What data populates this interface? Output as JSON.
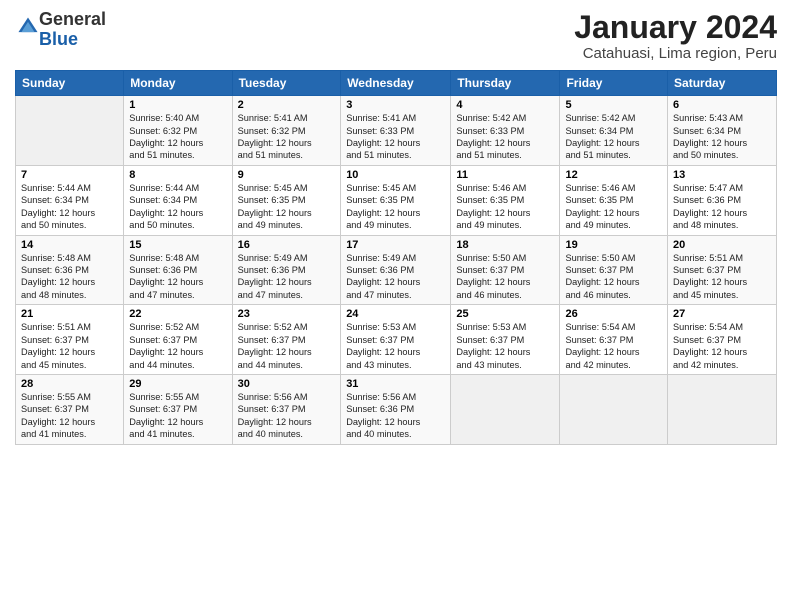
{
  "logo": {
    "general": "General",
    "blue": "Blue"
  },
  "header": {
    "title": "January 2024",
    "subtitle": "Catahuasi, Lima region, Peru"
  },
  "columns": [
    "Sunday",
    "Monday",
    "Tuesday",
    "Wednesday",
    "Thursday",
    "Friday",
    "Saturday"
  ],
  "weeks": [
    [
      {
        "day": "",
        "info": ""
      },
      {
        "day": "1",
        "info": "Sunrise: 5:40 AM\nSunset: 6:32 PM\nDaylight: 12 hours\nand 51 minutes."
      },
      {
        "day": "2",
        "info": "Sunrise: 5:41 AM\nSunset: 6:32 PM\nDaylight: 12 hours\nand 51 minutes."
      },
      {
        "day": "3",
        "info": "Sunrise: 5:41 AM\nSunset: 6:33 PM\nDaylight: 12 hours\nand 51 minutes."
      },
      {
        "day": "4",
        "info": "Sunrise: 5:42 AM\nSunset: 6:33 PM\nDaylight: 12 hours\nand 51 minutes."
      },
      {
        "day": "5",
        "info": "Sunrise: 5:42 AM\nSunset: 6:34 PM\nDaylight: 12 hours\nand 51 minutes."
      },
      {
        "day": "6",
        "info": "Sunrise: 5:43 AM\nSunset: 6:34 PM\nDaylight: 12 hours\nand 50 minutes."
      }
    ],
    [
      {
        "day": "7",
        "info": "Sunrise: 5:44 AM\nSunset: 6:34 PM\nDaylight: 12 hours\nand 50 minutes."
      },
      {
        "day": "8",
        "info": "Sunrise: 5:44 AM\nSunset: 6:34 PM\nDaylight: 12 hours\nand 50 minutes."
      },
      {
        "day": "9",
        "info": "Sunrise: 5:45 AM\nSunset: 6:35 PM\nDaylight: 12 hours\nand 49 minutes."
      },
      {
        "day": "10",
        "info": "Sunrise: 5:45 AM\nSunset: 6:35 PM\nDaylight: 12 hours\nand 49 minutes."
      },
      {
        "day": "11",
        "info": "Sunrise: 5:46 AM\nSunset: 6:35 PM\nDaylight: 12 hours\nand 49 minutes."
      },
      {
        "day": "12",
        "info": "Sunrise: 5:46 AM\nSunset: 6:35 PM\nDaylight: 12 hours\nand 49 minutes."
      },
      {
        "day": "13",
        "info": "Sunrise: 5:47 AM\nSunset: 6:36 PM\nDaylight: 12 hours\nand 48 minutes."
      }
    ],
    [
      {
        "day": "14",
        "info": "Sunrise: 5:48 AM\nSunset: 6:36 PM\nDaylight: 12 hours\nand 48 minutes."
      },
      {
        "day": "15",
        "info": "Sunrise: 5:48 AM\nSunset: 6:36 PM\nDaylight: 12 hours\nand 47 minutes."
      },
      {
        "day": "16",
        "info": "Sunrise: 5:49 AM\nSunset: 6:36 PM\nDaylight: 12 hours\nand 47 minutes."
      },
      {
        "day": "17",
        "info": "Sunrise: 5:49 AM\nSunset: 6:36 PM\nDaylight: 12 hours\nand 47 minutes."
      },
      {
        "day": "18",
        "info": "Sunrise: 5:50 AM\nSunset: 6:37 PM\nDaylight: 12 hours\nand 46 minutes."
      },
      {
        "day": "19",
        "info": "Sunrise: 5:50 AM\nSunset: 6:37 PM\nDaylight: 12 hours\nand 46 minutes."
      },
      {
        "day": "20",
        "info": "Sunrise: 5:51 AM\nSunset: 6:37 PM\nDaylight: 12 hours\nand 45 minutes."
      }
    ],
    [
      {
        "day": "21",
        "info": "Sunrise: 5:51 AM\nSunset: 6:37 PM\nDaylight: 12 hours\nand 45 minutes."
      },
      {
        "day": "22",
        "info": "Sunrise: 5:52 AM\nSunset: 6:37 PM\nDaylight: 12 hours\nand 44 minutes."
      },
      {
        "day": "23",
        "info": "Sunrise: 5:52 AM\nSunset: 6:37 PM\nDaylight: 12 hours\nand 44 minutes."
      },
      {
        "day": "24",
        "info": "Sunrise: 5:53 AM\nSunset: 6:37 PM\nDaylight: 12 hours\nand 43 minutes."
      },
      {
        "day": "25",
        "info": "Sunrise: 5:53 AM\nSunset: 6:37 PM\nDaylight: 12 hours\nand 43 minutes."
      },
      {
        "day": "26",
        "info": "Sunrise: 5:54 AM\nSunset: 6:37 PM\nDaylight: 12 hours\nand 42 minutes."
      },
      {
        "day": "27",
        "info": "Sunrise: 5:54 AM\nSunset: 6:37 PM\nDaylight: 12 hours\nand 42 minutes."
      }
    ],
    [
      {
        "day": "28",
        "info": "Sunrise: 5:55 AM\nSunset: 6:37 PM\nDaylight: 12 hours\nand 41 minutes."
      },
      {
        "day": "29",
        "info": "Sunrise: 5:55 AM\nSunset: 6:37 PM\nDaylight: 12 hours\nand 41 minutes."
      },
      {
        "day": "30",
        "info": "Sunrise: 5:56 AM\nSunset: 6:37 PM\nDaylight: 12 hours\nand 40 minutes."
      },
      {
        "day": "31",
        "info": "Sunrise: 5:56 AM\nSunset: 6:36 PM\nDaylight: 12 hours\nand 40 minutes."
      },
      {
        "day": "",
        "info": ""
      },
      {
        "day": "",
        "info": ""
      },
      {
        "day": "",
        "info": ""
      }
    ]
  ]
}
